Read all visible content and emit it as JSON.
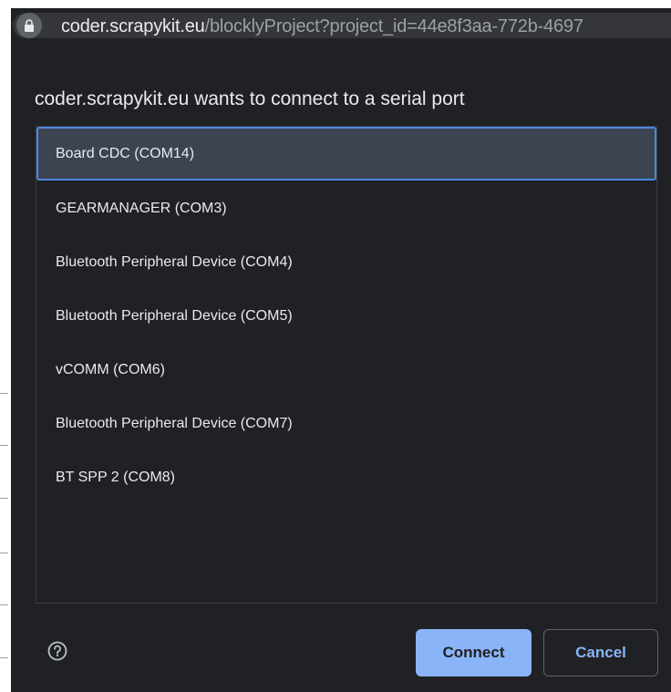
{
  "address_bar": {
    "host": "coder.scrapykit.eu",
    "path": "/blocklyProject?project_id=44e8f3aa-772b-4697"
  },
  "dialog": {
    "title": "coder.scrapykit.eu wants to connect to a serial port",
    "ports": [
      {
        "label": "Board CDC (COM14)",
        "selected": true
      },
      {
        "label": "GEARMANAGER (COM3)",
        "selected": false
      },
      {
        "label": "Bluetooth Peripheral Device (COM4)",
        "selected": false
      },
      {
        "label": "Bluetooth Peripheral Device (COM5)",
        "selected": false
      },
      {
        "label": "vCOMM (COM6)",
        "selected": false
      },
      {
        "label": "Bluetooth Peripheral Device (COM7)",
        "selected": false
      },
      {
        "label": "BT SPP 2 (COM8)",
        "selected": false
      }
    ],
    "help_icon": "help-circle-icon",
    "connect_label": "Connect",
    "cancel_label": "Cancel"
  },
  "colors": {
    "dialog_bg": "#202124",
    "text": "#e8eaed",
    "accent": "#8ab4f8",
    "selected_bg": "#3c4452",
    "selected_border": "#4d87e0"
  }
}
